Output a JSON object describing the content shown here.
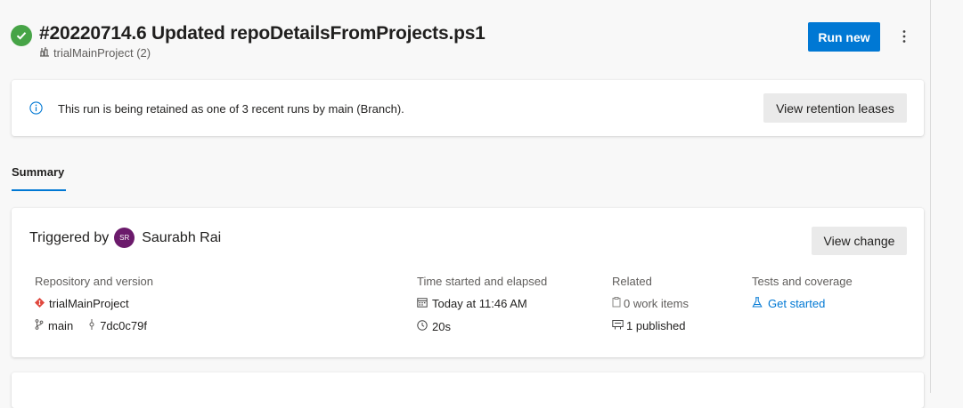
{
  "header": {
    "run_title": "#20220714.6 Updated repoDetailsFromProjects.ps1",
    "pipeline_name": "trialMainProject (2)",
    "run_new_label": "Run new",
    "status_icon": "success-check-icon",
    "status_color": "#47a447"
  },
  "banner": {
    "message": "This run is being retained as one of 3 recent runs by main (Branch).",
    "button_label": "View retention leases"
  },
  "tabs": [
    {
      "label": "Summary",
      "selected": true
    }
  ],
  "summary": {
    "triggered_label": "Triggered by",
    "user_initials": "SR",
    "user_name": "Saurabh Rai",
    "view_change_label": "View change",
    "repository": {
      "heading": "Repository and version",
      "repo_name": "trialMainProject",
      "branch": "main",
      "commit": "7dc0c79f"
    },
    "time": {
      "heading": "Time started and elapsed",
      "started": "Today at 11:46 AM",
      "elapsed": "20s"
    },
    "related": {
      "heading": "Related",
      "work_items": "0 work items",
      "published": "1 published"
    },
    "tests": {
      "heading": "Tests and coverage",
      "link": "Get started"
    }
  },
  "colors": {
    "accent": "#0078d4",
    "avatar": "#6b1a6b",
    "repo_icon": "#e0483e"
  }
}
